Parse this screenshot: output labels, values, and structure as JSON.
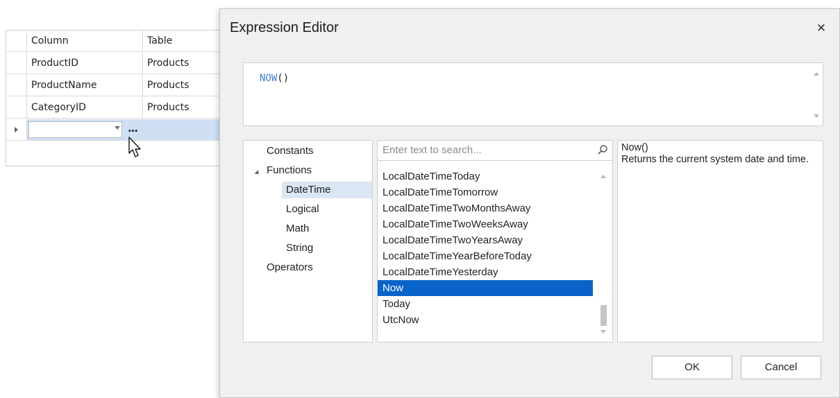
{
  "grid": {
    "headers": [
      "Column",
      "Table"
    ],
    "rows": [
      {
        "column": "ProductID",
        "table": "Products"
      },
      {
        "column": "ProductName",
        "table": "Products"
      },
      {
        "column": "CategoryID",
        "table": "Products"
      }
    ],
    "ellipsis": "...",
    "selected_row_color": "#cfe0f5"
  },
  "dialog": {
    "title": "Expression Editor",
    "close_glyph": "✕",
    "expression": {
      "function": "NOW",
      "args": "()"
    },
    "categories": [
      {
        "label": "Constants"
      },
      {
        "label": "Functions"
      },
      {
        "label": "DateTime"
      },
      {
        "label": "Logical"
      },
      {
        "label": "Math"
      },
      {
        "label": "String"
      },
      {
        "label": "Operators"
      }
    ],
    "selected_category": "DateTime",
    "search_placeholder": "Enter text to search...",
    "functions": [
      {
        "label": "LocalDateTimeToday"
      },
      {
        "label": "LocalDateTimeTomorrow"
      },
      {
        "label": "LocalDateTimeTwoMonthsAway"
      },
      {
        "label": "LocalDateTimeTwoWeeksAway"
      },
      {
        "label": "LocalDateTimeTwoYearsAway"
      },
      {
        "label": "LocalDateTimeYearBeforeToday"
      },
      {
        "label": "LocalDateTimeYesterday"
      },
      {
        "label": "Now"
      },
      {
        "label": "Today"
      },
      {
        "label": "UtcNow"
      }
    ],
    "selected_function": "Now",
    "description": {
      "title": "Now()",
      "text": "Returns the current system date and time."
    },
    "ok_label": "OK",
    "cancel_label": "Cancel",
    "accent_color": "#0a63c9",
    "function_color": "#3a7fd5"
  }
}
